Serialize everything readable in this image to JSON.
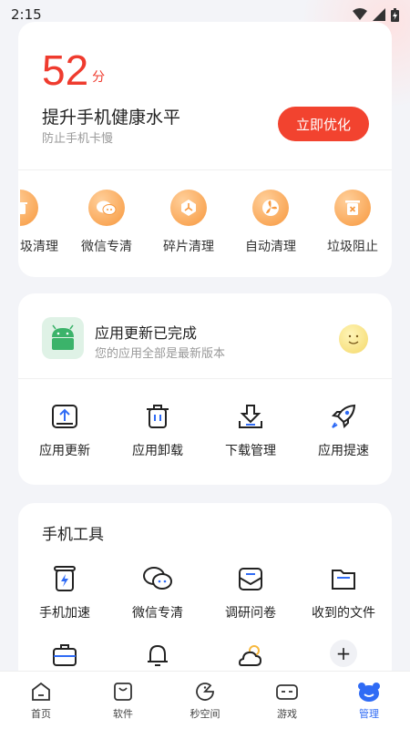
{
  "status_bar": {
    "time": "2:15"
  },
  "score_card": {
    "score": "52",
    "unit": "分",
    "title": "提升手机健康水平",
    "subtitle": "防止手机卡慢",
    "button": "立即优化",
    "quick_items": [
      {
        "label": "圾清理",
        "icon": "trash-can-icon"
      },
      {
        "label": "微信专清",
        "icon": "wechat-icon"
      },
      {
        "label": "碎片清理",
        "icon": "fragment-icon"
      },
      {
        "label": "自动清理",
        "icon": "fan-icon"
      },
      {
        "label": "垃圾阻止",
        "icon": "block-icon"
      }
    ]
  },
  "update_card": {
    "title": "应用更新已完成",
    "subtitle": "您的应用全部是最新版本",
    "tools": [
      {
        "label": "应用更新",
        "icon": "upload-box-icon"
      },
      {
        "label": "应用卸载",
        "icon": "trash-icon"
      },
      {
        "label": "下载管理",
        "icon": "download-icon"
      },
      {
        "label": "应用提速",
        "icon": "rocket-icon"
      }
    ]
  },
  "tools_card": {
    "title": "手机工具",
    "row1": [
      {
        "label": "手机加速",
        "icon": "battery-bolt-icon"
      },
      {
        "label": "微信专清",
        "icon": "chat-bubbles-icon"
      },
      {
        "label": "调研问卷",
        "icon": "mail-icon"
      },
      {
        "label": "收到的文件",
        "icon": "folder-icon"
      }
    ],
    "row2": [
      {
        "icon": "briefcase-icon"
      },
      {
        "icon": "bell-icon"
      },
      {
        "icon": "weather-icon"
      },
      {
        "icon": "plus-icon",
        "text": "+"
      }
    ]
  },
  "bottom_nav": [
    {
      "label": "首页",
      "icon": "home-icon"
    },
    {
      "label": "软件",
      "icon": "software-icon"
    },
    {
      "label": "秒空间",
      "icon": "space-icon"
    },
    {
      "label": "游戏",
      "icon": "game-icon"
    },
    {
      "label": "管理",
      "icon": "manage-icon",
      "active": true
    }
  ],
  "colors": {
    "accent": "#f2432f",
    "score": "#ef3b2e",
    "nav_active": "#2f6bf5",
    "orange": "#f7983e"
  }
}
